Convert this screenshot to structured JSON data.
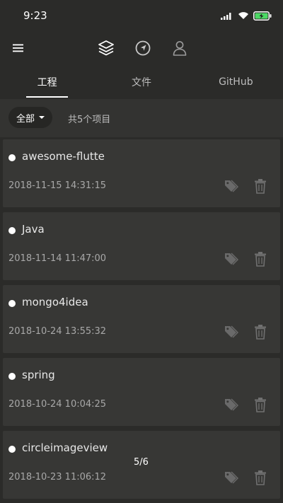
{
  "status_bar": {
    "time": "9:23"
  },
  "tabs": [
    {
      "label": "工程",
      "active": true
    },
    {
      "label": "文件",
      "active": false
    },
    {
      "label": "GitHub",
      "active": false
    }
  ],
  "filter": {
    "selected": "全部",
    "count_text": "共5个项目"
  },
  "projects": [
    {
      "name": "awesome-flutte",
      "date": "2018-11-15 14:31:15"
    },
    {
      "name": "Java",
      "date": "2018-11-14 11:47:00"
    },
    {
      "name": "mongo4idea",
      "date": "2018-10-24 13:55:32"
    },
    {
      "name": "spring",
      "date": "2018-10-24 10:04:25"
    },
    {
      "name": "circleimageview",
      "date": "2018-10-23 11:06:12"
    }
  ],
  "page_indicator": "5/6",
  "colors": {
    "background": "#2b2b29",
    "card": "#373735",
    "battery": "#4cd964"
  },
  "icons": {
    "app_bar": [
      "menu-icon",
      "layers-icon",
      "navigation-icon",
      "person-icon"
    ],
    "row_actions": [
      "tag-icon",
      "trash-icon"
    ]
  }
}
